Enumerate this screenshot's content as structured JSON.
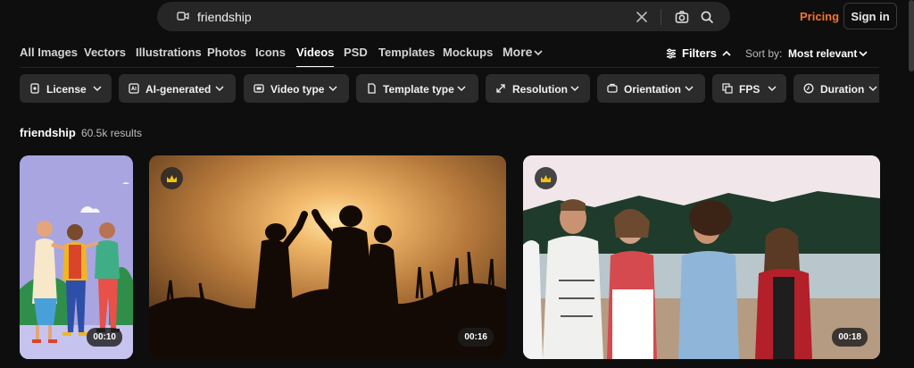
{
  "search": {
    "query": "friendship",
    "video_icon": "video-camera-icon",
    "clear_icon": "close-icon",
    "camera_icon": "camera-icon",
    "search_icon": "search-icon"
  },
  "header": {
    "pricing": "Pricing",
    "signin": "Sign in",
    "accent": "#f4742b"
  },
  "tabs": [
    {
      "label": "All Images"
    },
    {
      "label": "Vectors"
    },
    {
      "label": "Illustrations"
    },
    {
      "label": "Photos"
    },
    {
      "label": "Icons"
    },
    {
      "label": "Videos",
      "active": true
    },
    {
      "label": "PSD"
    },
    {
      "label": "Templates"
    },
    {
      "label": "Mockups"
    },
    {
      "label": "More"
    }
  ],
  "toolbar": {
    "filters": "Filters",
    "sort_label": "Sort by:",
    "sort_value": "Most relevant"
  },
  "chips": [
    {
      "label": "License",
      "icon": "license-icon"
    },
    {
      "label": "AI-generated",
      "icon": "ai-icon"
    },
    {
      "label": "Video type",
      "icon": "video-type-icon"
    },
    {
      "label": "Template type",
      "icon": "template-icon"
    },
    {
      "label": "Resolution",
      "icon": "resolution-icon"
    },
    {
      "label": "Orientation",
      "icon": "orientation-icon"
    },
    {
      "label": "FPS",
      "icon": "fps-icon"
    },
    {
      "label": "Duration",
      "icon": "clock-icon"
    }
  ],
  "results": {
    "title": "friendship",
    "count": "60.5k results"
  },
  "cards": [
    {
      "duration": "00:10",
      "premium": false
    },
    {
      "duration": "00:16",
      "premium": true
    },
    {
      "duration": "00:18",
      "premium": true
    }
  ]
}
